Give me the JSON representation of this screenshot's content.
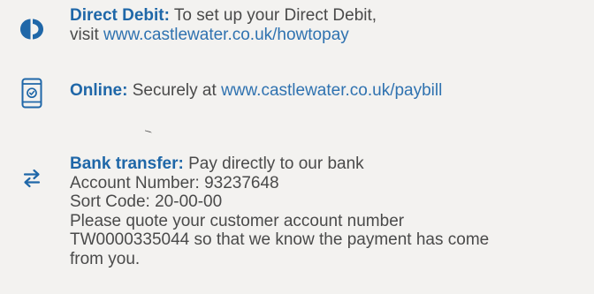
{
  "payment_methods": {
    "direct_debit": {
      "icon": "direct-debit-icon",
      "label": "Direct Debit:",
      "text": "To set up your Direct Debit,",
      "visit_prefix": "visit",
      "link": "www.castlewater.co.uk/howtopay"
    },
    "online": {
      "icon": "mobile-phone-icon",
      "label": "Online:",
      "text": "Securely at",
      "link": "www.castlewater.co.uk/paybill"
    },
    "bank_transfer": {
      "icon": "transfer-arrows-icon",
      "label": "Bank transfer:",
      "text": "Pay directly to our bank",
      "account_number": "Account Number: 93237648",
      "sort_code": "Sort Code: 20-00-00",
      "note_line1": "Please quote your customer account number",
      "note_line2": "TW0000335044 so that we know the payment has come",
      "note_line3": "from you."
    }
  },
  "colors": {
    "label": "#1f67a8",
    "link": "#2f72b0",
    "body_text": "#4a4a4a",
    "icon": "#1f67a8",
    "background": "#f3f2f0"
  }
}
